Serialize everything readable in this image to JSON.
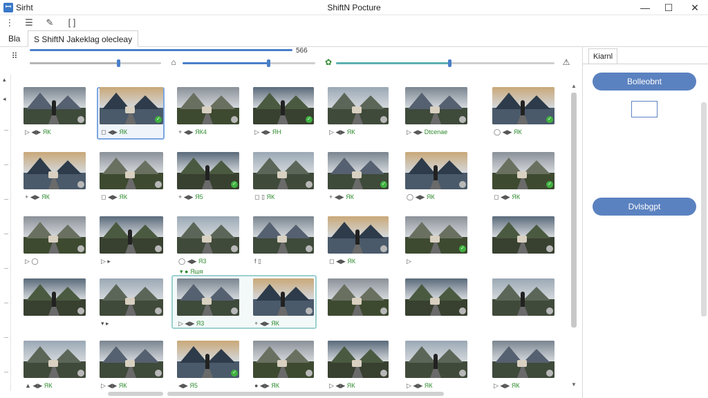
{
  "titlebar": {
    "app_name": "Sirht",
    "title": "ShiftN Pocture",
    "minimize_glyph": "—",
    "maximize_glyph": "☐",
    "close_glyph": "✕"
  },
  "toolbar": {
    "icons": [
      "list-tree-icon",
      "align-icon",
      "eyedropper-icon",
      "brackets-icon"
    ],
    "brackets_label": "[ ]"
  },
  "tabs": [
    {
      "label": "Bla"
    },
    {
      "label": "S ShiftN Jakeklag olecleay"
    }
  ],
  "sliders": {
    "progress_label": "566",
    "progress_percent": 100
  },
  "grid": {
    "rows": [
      [
        {
          "icons": "▷ ◀▶",
          "label": "ЯК",
          "badge": "no"
        },
        {
          "icons": "◻ ◀▶",
          "label": "ЯК",
          "badge": "ok"
        },
        {
          "icons": "+ ◀▶",
          "label": "ЯК4",
          "badge": "no"
        },
        {
          "icons": "▷ ◀▶",
          "label": "ЯН",
          "badge": "ok"
        },
        {
          "icons": "▷ ◀▶",
          "label": "ЯК",
          "badge": "no"
        },
        {
          "icons": "▷ ◀▶",
          "label": "Dtcenae",
          "badge": "no"
        },
        {
          "icons": "◯ ◀▶",
          "label": "ЯК",
          "badge": "ok"
        }
      ],
      [
        {
          "icons": "+ ◀▶",
          "label": "ЯК",
          "badge": "no"
        },
        {
          "icons": "◻ ◀▶",
          "label": "ЯК",
          "badge": "no"
        },
        {
          "icons": "+ ◀▶",
          "label": "Я5",
          "badge": "ok"
        },
        {
          "icons": "◻ ▯",
          "label": "ЯК",
          "badge": "no"
        },
        {
          "icons": "+ ◀▶",
          "label": "ЯК",
          "badge": "ok"
        },
        {
          "icons": "◯ ◀▶",
          "label": "ЯК",
          "badge": "no"
        },
        {
          "icons": "◻ ◀▶",
          "label": "ЯК",
          "badge": "ok"
        }
      ],
      [
        {
          "icons": "▷ ◯",
          "label": "",
          "badge": "no"
        },
        {
          "icons": "▷ ▸",
          "label": "",
          "badge": "no"
        },
        {
          "icons": "◯ ◀▶",
          "label": "Я3",
          "badge": "no"
        },
        {
          "icons": "f ▯",
          "label": "",
          "badge": "no"
        },
        {
          "icons": "◻ ◀▶",
          "label": "ЯК",
          "badge": "no"
        },
        {
          "icons": "▷",
          "label": "",
          "badge": "ok"
        },
        {
          "icons": "",
          "label": "",
          "badge": "no"
        }
      ],
      [
        {
          "icons": "",
          "label": "",
          "badge": "no"
        },
        {
          "icons": "▾ ▸",
          "label": "",
          "badge": "no"
        },
        {
          "icons": "▷ ◀▶",
          "label": "Я3",
          "badge": "no"
        },
        {
          "icons": "+ ◀▶",
          "label": "ЯК",
          "badge": "no"
        },
        {
          "icons": "",
          "label": "",
          "badge": "no"
        },
        {
          "icons": "",
          "label": "",
          "badge": "no"
        },
        {
          "icons": "",
          "label": "",
          "badge": "no"
        }
      ],
      [
        {
          "icons": "▲ ◀▶",
          "label": "ЯК",
          "badge": "no"
        },
        {
          "icons": "▷ ◀▶",
          "label": "ЯК",
          "badge": "no"
        },
        {
          "icons": "◀▶",
          "label": "Я5",
          "badge": "ok"
        },
        {
          "icons": "● ◀▶",
          "label": "ЯК",
          "badge": "no"
        },
        {
          "icons": "▷ ◀▶",
          "label": "ЯК",
          "badge": "no"
        },
        {
          "icons": "▷ ◀▶",
          "label": "ЯК",
          "badge": "no"
        },
        {
          "icons": "▷ ◀▶",
          "label": "ЯК",
          "badge": "no"
        }
      ]
    ],
    "extra_label": "▾ ● Яшя"
  },
  "right_panel": {
    "tab_label": "Kiarnl",
    "button1_label": "Bolleobnt",
    "button2_label": "Dvlsbgpt"
  }
}
